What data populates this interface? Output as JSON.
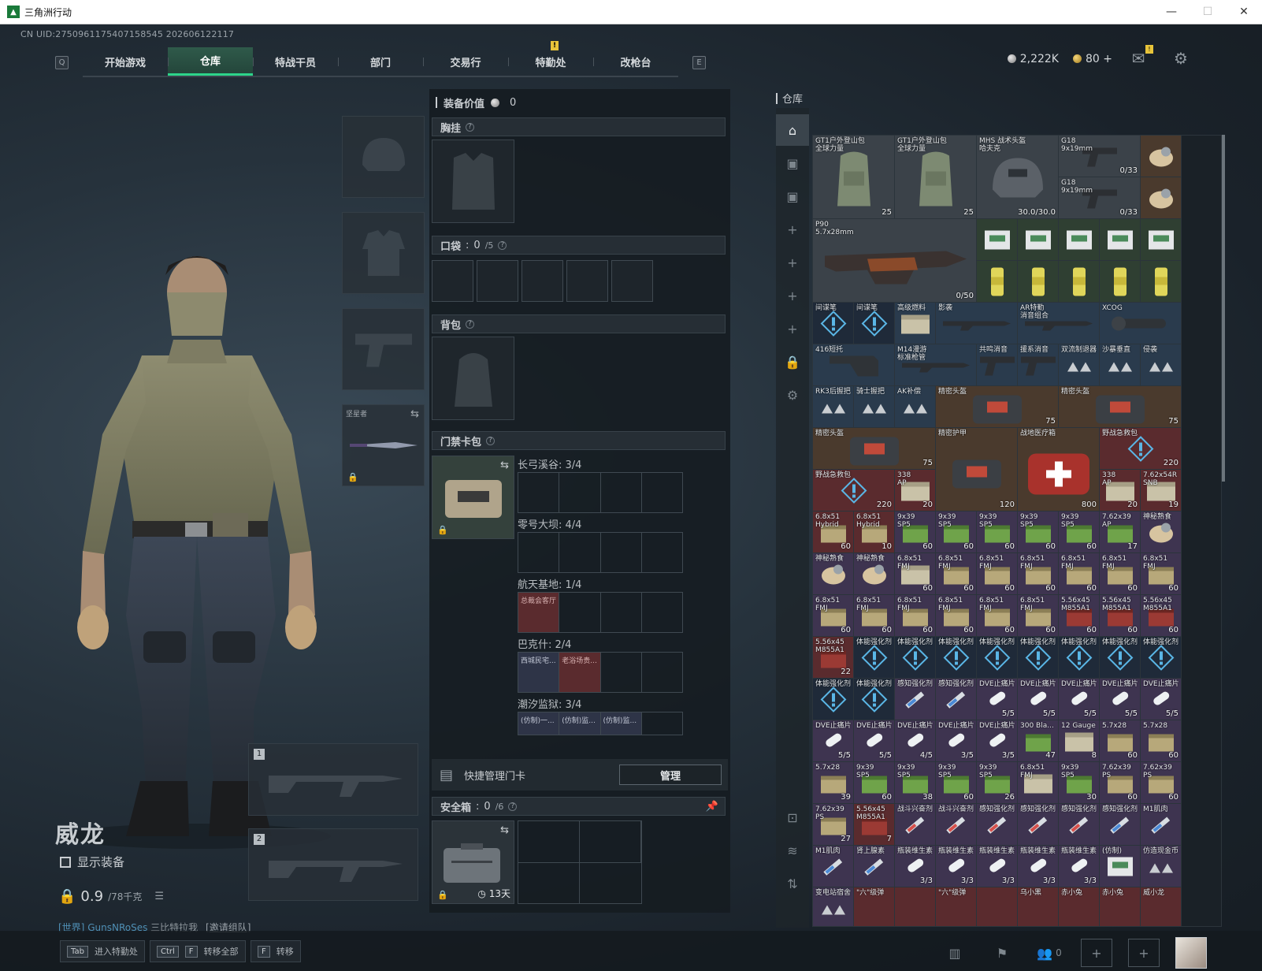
{
  "window": {
    "title": "三角洲行动",
    "min": "—",
    "max": "☐",
    "close": "✕"
  },
  "uid": "CN UID:2750961175407158545 202606122117",
  "nav": {
    "left_key": "Q",
    "right_key": "E",
    "tabs": [
      "开始游戏",
      "仓库",
      "特战干员",
      "部门",
      "交易行",
      "特勤处",
      "改枪台"
    ],
    "active_tab": "仓库",
    "tab_badge": "!"
  },
  "currency": {
    "silver": "2,222K",
    "gold": "80",
    "plus": "+"
  },
  "header_badge": "!",
  "character": {
    "name": "威龙",
    "show_equipment": "显示装备",
    "weight": "0.9",
    "weight_max": "/78千克",
    "chat_channel": "[世界]",
    "chat_nick": "GunsNRoSes",
    "chat_msg": "三比特拉我",
    "chat_invite": "[邀请组队]"
  },
  "equip_slots": {
    "melee_label": "坚星者",
    "weapon1": "1",
    "weapon2": "2"
  },
  "mid": {
    "value_label": "装备价值",
    "value": "0",
    "chest": "胸挂",
    "pocket": "口袋",
    "pocket_count": "0",
    "pocket_max": "/5",
    "backpack": "背包",
    "keybag": "门禁卡包",
    "maps": [
      {
        "name": "长弓溪谷: 3/4",
        "cells": []
      },
      {
        "name": "零号大坝: 4/4",
        "cells": []
      },
      {
        "name": "航天基地: 1/4",
        "cells": [
          "总裁会客厅"
        ]
      },
      {
        "name": "巴克什: 2/4",
        "cells": [
          "西城民宅...",
          "老浴场贵..."
        ]
      },
      {
        "name": "潮汐监狱: 3/4",
        "cells": [
          "(仿制)一...",
          "(仿制)监...",
          "(仿制)监..."
        ]
      }
    ],
    "quick_manage": "快捷管理门卡",
    "manage_btn": "管理",
    "safebox": "安全箱",
    "safebox_count": "0",
    "safebox_max": "/6",
    "safebox_time": "13天"
  },
  "storage": {
    "title": "仓库",
    "items": [
      {
        "nm": "GT1户外登山包\n全球力量",
        "ct": "25"
      },
      {
        "nm": "GT1户外登山包\n全球力量",
        "ct": "25"
      },
      {
        "nm": "MHS 战术头盔\n哈夫克",
        "ct": "30.0/30.0"
      },
      {
        "nm": "G18\n9x19mm",
        "ct": "0/33"
      },
      {
        "nm": "G18\n9x19mm",
        "ct": "0/33"
      },
      {
        "nm": "P90\n5.7x28mm",
        "ct": "0/50"
      },
      {
        "nm": "间谍笔",
        "ct": ""
      },
      {
        "nm": "间谍笔",
        "ct": ""
      },
      {
        "nm": "高级燃料",
        "ct": ""
      },
      {
        "nm": "影袭",
        "ct": ""
      },
      {
        "nm": "AR特勤\n消音组合",
        "ct": ""
      },
      {
        "nm": "XCOG",
        "ct": ""
      },
      {
        "nm": "416短托",
        "ct": ""
      },
      {
        "nm": "M14漫游\n标准枪管",
        "ct": ""
      },
      {
        "nm": "共鸣消音",
        "ct": ""
      },
      {
        "nm": "援系消音",
        "ct": ""
      },
      {
        "nm": "双流制退器",
        "ct": ""
      },
      {
        "nm": "沙暴垂直",
        "ct": ""
      },
      {
        "nm": "侵袭",
        "ct": ""
      },
      {
        "nm": "RK3后握把",
        "ct": ""
      },
      {
        "nm": "骑士握把",
        "ct": ""
      },
      {
        "nm": "AK补偿",
        "ct": ""
      },
      {
        "nm": "精密头盔",
        "ct": "75"
      },
      {
        "nm": "精密头盔",
        "ct": "75"
      },
      {
        "nm": "精密头盔",
        "ct": "75"
      },
      {
        "nm": "精密护甲",
        "ct": "120"
      },
      {
        "nm": "战地医疗箱",
        "ct": "800"
      },
      {
        "nm": "野战急救包",
        "ct": "220"
      },
      {
        "nm": "野战急救包",
        "ct": "220"
      },
      {
        "nm": "338\nAP",
        "ct": "20"
      },
      {
        "nm": "338\nAP",
        "ct": "20"
      },
      {
        "nm": "7.62x54R\nSNB",
        "ct": "19"
      }
    ],
    "ammo_labels": [
      "6.8x51\nHybrid",
      "9x39\nSP5",
      "7.62x39\nAP",
      "神秘熟食",
      "6.8x51\nFMJ",
      "5.56x45\nM855A1",
      "体能强化剂",
      "感知强化剂",
      "DVE止痛片",
      "300 Bla...",
      "12 Gauge",
      "5.7x28",
      "7.62x39\nPS",
      "战斗兴奋剂",
      "M1肌肉",
      "肾上腺素",
      "瓶装维生素",
      "(仿制)",
      "仿造现金币",
      "变电站宿舍",
      "\"六\"级弹",
      "乌小黑",
      "赤小兔",
      "威小龙"
    ],
    "ammo_counts": [
      "60",
      "10",
      "17",
      "5/5",
      "47",
      "8",
      "39",
      "38",
      "26",
      "30",
      "27",
      "7",
      "4/5",
      "3/5",
      "3/3",
      "22"
    ]
  },
  "bottom": {
    "hint1_key": "Tab",
    "hint1": "进入特勤处",
    "hint2_key1": "Ctrl",
    "hint2_key2": "F",
    "hint2": "转移全部",
    "hint3_key": "F",
    "hint3": "转移",
    "friends": "0"
  },
  "colors": {
    "accent": "#2dd48a",
    "tab_active": "#2f5a4a",
    "red_card": "#5a2b2e",
    "badge": "#e8c43a"
  }
}
